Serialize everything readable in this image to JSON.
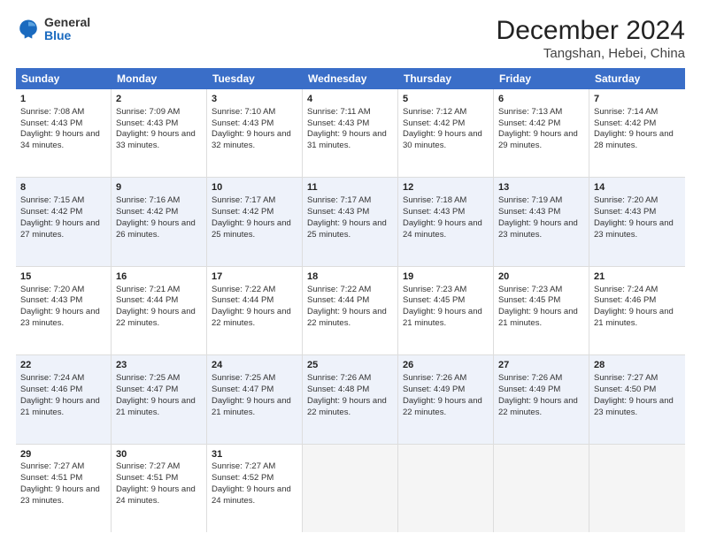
{
  "logo": {
    "general": "General",
    "blue": "Blue"
  },
  "title": "December 2024",
  "location": "Tangshan, Hebei, China",
  "days_of_week": [
    "Sunday",
    "Monday",
    "Tuesday",
    "Wednesday",
    "Thursday",
    "Friday",
    "Saturday"
  ],
  "weeks": [
    [
      {
        "day": "1",
        "sunrise": "Sunrise: 7:08 AM",
        "sunset": "Sunset: 4:43 PM",
        "daylight": "Daylight: 9 hours and 34 minutes."
      },
      {
        "day": "2",
        "sunrise": "Sunrise: 7:09 AM",
        "sunset": "Sunset: 4:43 PM",
        "daylight": "Daylight: 9 hours and 33 minutes."
      },
      {
        "day": "3",
        "sunrise": "Sunrise: 7:10 AM",
        "sunset": "Sunset: 4:43 PM",
        "daylight": "Daylight: 9 hours and 32 minutes."
      },
      {
        "day": "4",
        "sunrise": "Sunrise: 7:11 AM",
        "sunset": "Sunset: 4:43 PM",
        "daylight": "Daylight: 9 hours and 31 minutes."
      },
      {
        "day": "5",
        "sunrise": "Sunrise: 7:12 AM",
        "sunset": "Sunset: 4:42 PM",
        "daylight": "Daylight: 9 hours and 30 minutes."
      },
      {
        "day": "6",
        "sunrise": "Sunrise: 7:13 AM",
        "sunset": "Sunset: 4:42 PM",
        "daylight": "Daylight: 9 hours and 29 minutes."
      },
      {
        "day": "7",
        "sunrise": "Sunrise: 7:14 AM",
        "sunset": "Sunset: 4:42 PM",
        "daylight": "Daylight: 9 hours and 28 minutes."
      }
    ],
    [
      {
        "day": "8",
        "sunrise": "Sunrise: 7:15 AM",
        "sunset": "Sunset: 4:42 PM",
        "daylight": "Daylight: 9 hours and 27 minutes."
      },
      {
        "day": "9",
        "sunrise": "Sunrise: 7:16 AM",
        "sunset": "Sunset: 4:42 PM",
        "daylight": "Daylight: 9 hours and 26 minutes."
      },
      {
        "day": "10",
        "sunrise": "Sunrise: 7:17 AM",
        "sunset": "Sunset: 4:42 PM",
        "daylight": "Daylight: 9 hours and 25 minutes."
      },
      {
        "day": "11",
        "sunrise": "Sunrise: 7:17 AM",
        "sunset": "Sunset: 4:43 PM",
        "daylight": "Daylight: 9 hours and 25 minutes."
      },
      {
        "day": "12",
        "sunrise": "Sunrise: 7:18 AM",
        "sunset": "Sunset: 4:43 PM",
        "daylight": "Daylight: 9 hours and 24 minutes."
      },
      {
        "day": "13",
        "sunrise": "Sunrise: 7:19 AM",
        "sunset": "Sunset: 4:43 PM",
        "daylight": "Daylight: 9 hours and 23 minutes."
      },
      {
        "day": "14",
        "sunrise": "Sunrise: 7:20 AM",
        "sunset": "Sunset: 4:43 PM",
        "daylight": "Daylight: 9 hours and 23 minutes."
      }
    ],
    [
      {
        "day": "15",
        "sunrise": "Sunrise: 7:20 AM",
        "sunset": "Sunset: 4:43 PM",
        "daylight": "Daylight: 9 hours and 23 minutes."
      },
      {
        "day": "16",
        "sunrise": "Sunrise: 7:21 AM",
        "sunset": "Sunset: 4:44 PM",
        "daylight": "Daylight: 9 hours and 22 minutes."
      },
      {
        "day": "17",
        "sunrise": "Sunrise: 7:22 AM",
        "sunset": "Sunset: 4:44 PM",
        "daylight": "Daylight: 9 hours and 22 minutes."
      },
      {
        "day": "18",
        "sunrise": "Sunrise: 7:22 AM",
        "sunset": "Sunset: 4:44 PM",
        "daylight": "Daylight: 9 hours and 22 minutes."
      },
      {
        "day": "19",
        "sunrise": "Sunrise: 7:23 AM",
        "sunset": "Sunset: 4:45 PM",
        "daylight": "Daylight: 9 hours and 21 minutes."
      },
      {
        "day": "20",
        "sunrise": "Sunrise: 7:23 AM",
        "sunset": "Sunset: 4:45 PM",
        "daylight": "Daylight: 9 hours and 21 minutes."
      },
      {
        "day": "21",
        "sunrise": "Sunrise: 7:24 AM",
        "sunset": "Sunset: 4:46 PM",
        "daylight": "Daylight: 9 hours and 21 minutes."
      }
    ],
    [
      {
        "day": "22",
        "sunrise": "Sunrise: 7:24 AM",
        "sunset": "Sunset: 4:46 PM",
        "daylight": "Daylight: 9 hours and 21 minutes."
      },
      {
        "day": "23",
        "sunrise": "Sunrise: 7:25 AM",
        "sunset": "Sunset: 4:47 PM",
        "daylight": "Daylight: 9 hours and 21 minutes."
      },
      {
        "day": "24",
        "sunrise": "Sunrise: 7:25 AM",
        "sunset": "Sunset: 4:47 PM",
        "daylight": "Daylight: 9 hours and 21 minutes."
      },
      {
        "day": "25",
        "sunrise": "Sunrise: 7:26 AM",
        "sunset": "Sunset: 4:48 PM",
        "daylight": "Daylight: 9 hours and 22 minutes."
      },
      {
        "day": "26",
        "sunrise": "Sunrise: 7:26 AM",
        "sunset": "Sunset: 4:49 PM",
        "daylight": "Daylight: 9 hours and 22 minutes."
      },
      {
        "day": "27",
        "sunrise": "Sunrise: 7:26 AM",
        "sunset": "Sunset: 4:49 PM",
        "daylight": "Daylight: 9 hours and 22 minutes."
      },
      {
        "day": "28",
        "sunrise": "Sunrise: 7:27 AM",
        "sunset": "Sunset: 4:50 PM",
        "daylight": "Daylight: 9 hours and 23 minutes."
      }
    ],
    [
      {
        "day": "29",
        "sunrise": "Sunrise: 7:27 AM",
        "sunset": "Sunset: 4:51 PM",
        "daylight": "Daylight: 9 hours and 23 minutes."
      },
      {
        "day": "30",
        "sunrise": "Sunrise: 7:27 AM",
        "sunset": "Sunset: 4:51 PM",
        "daylight": "Daylight: 9 hours and 24 minutes."
      },
      {
        "day": "31",
        "sunrise": "Sunrise: 7:27 AM",
        "sunset": "Sunset: 4:52 PM",
        "daylight": "Daylight: 9 hours and 24 minutes."
      },
      null,
      null,
      null,
      null
    ]
  ]
}
